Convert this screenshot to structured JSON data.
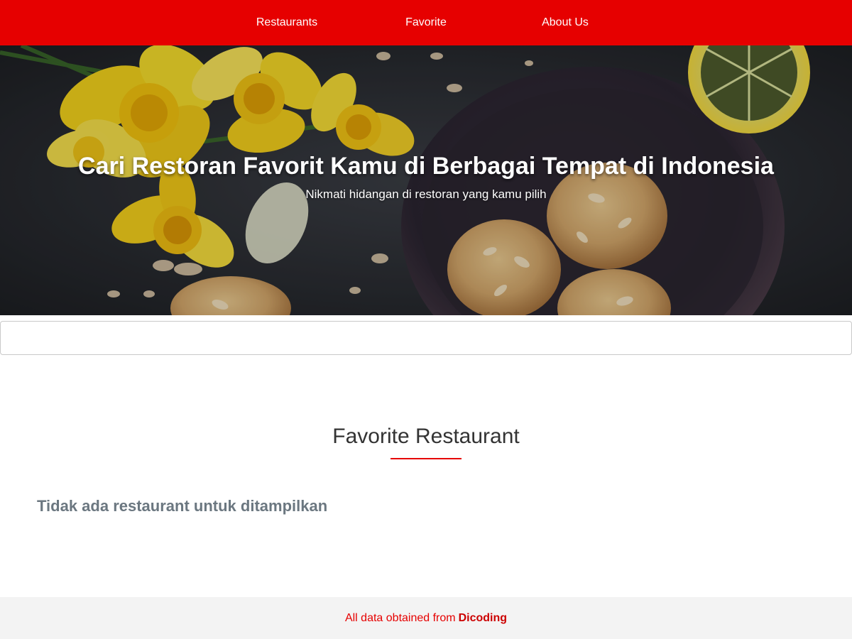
{
  "nav": {
    "items": [
      {
        "label": "Restaurants"
      },
      {
        "label": "Favorite"
      },
      {
        "label": "About Us"
      }
    ]
  },
  "hero": {
    "title": "Cari Restoran Favorit Kamu di Berbagai Tempat di Indonesia",
    "subtitle": "Nikmati hidangan di restoran yang kamu pilih"
  },
  "search": {
    "value": "",
    "placeholder": ""
  },
  "main": {
    "section_title": "Favorite Restaurant",
    "empty_message": "Tidak ada restaurant untuk ditampilkan"
  },
  "footer": {
    "text": "All data obtained from",
    "link_label": "Dicoding"
  },
  "colors": {
    "brand": "#e60000",
    "footer_bg": "#f3f3f3",
    "empty_text": "#6b7780"
  }
}
